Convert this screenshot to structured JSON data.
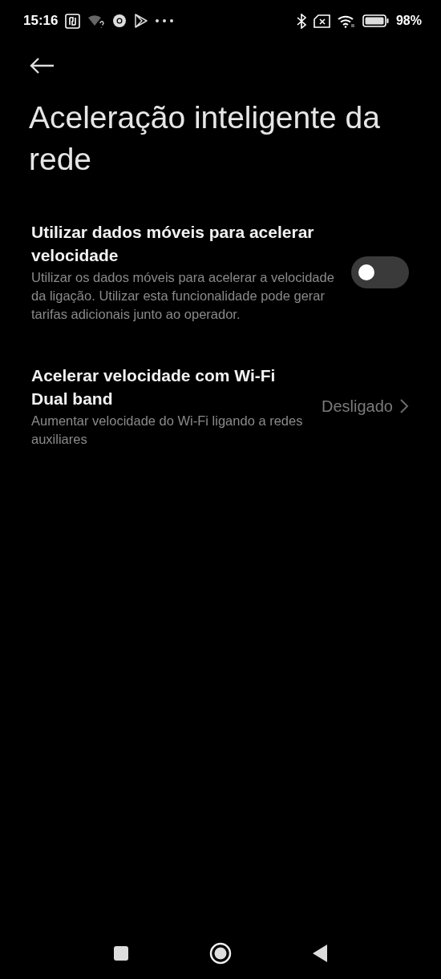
{
  "status_bar": {
    "time": "15:16",
    "battery": "98%"
  },
  "title": "Aceleração inteligente da rede",
  "items": [
    {
      "kind": "toggle",
      "title": "Utilizar dados móveis para acelerar velocidade",
      "description": "Utilizar os dados móveis para acelerar a velocidade da ligação. Utilizar esta funcionalidade pode gerar tarifas adicionais junto ao operador.",
      "on": false
    },
    {
      "kind": "link",
      "title": "Acelerar velocidade com Wi-Fi Dual band",
      "description": "Aumentar velocidade do Wi-Fi ligando a redes auxiliares",
      "value": "Desligado"
    }
  ]
}
